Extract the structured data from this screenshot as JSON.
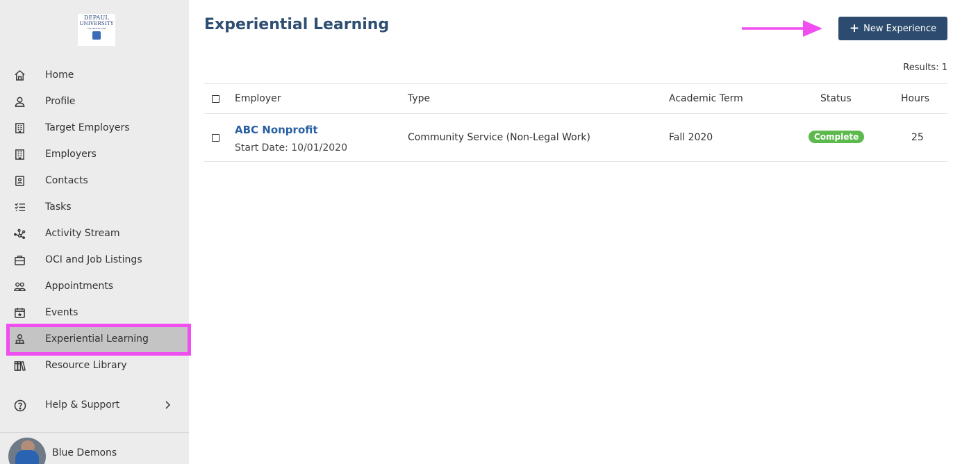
{
  "logo": {
    "line1": "DEPAUL",
    "line2": "UNIVERSITY",
    "line3": "COLLEGE OF LAW"
  },
  "sidebar": {
    "items": [
      {
        "label": "Home",
        "icon": "home-icon"
      },
      {
        "label": "Profile",
        "icon": "user-icon"
      },
      {
        "label": "Target Employers",
        "icon": "building-icon"
      },
      {
        "label": "Employers",
        "icon": "building-icon"
      },
      {
        "label": "Contacts",
        "icon": "contacts-icon"
      },
      {
        "label": "Tasks",
        "icon": "tasks-icon"
      },
      {
        "label": "Activity Stream",
        "icon": "activity-icon"
      },
      {
        "label": "OCI and Job Listings",
        "icon": "briefcase-icon"
      },
      {
        "label": "Appointments",
        "icon": "people-icon"
      },
      {
        "label": "Events",
        "icon": "calendar-icon"
      },
      {
        "label": "Experiential Learning",
        "icon": "learning-icon",
        "active": true
      },
      {
        "label": "Resource Library",
        "icon": "library-icon"
      }
    ],
    "help": "Help & Support",
    "user": "Blue Demons"
  },
  "main": {
    "title": "Experiential Learning",
    "new_button": "New Experience",
    "results": "Results: 1",
    "columns": {
      "employer": "Employer",
      "type": "Type",
      "term": "Academic Term",
      "status": "Status",
      "hours": "Hours"
    },
    "rows": [
      {
        "employer": "ABC Nonprofit",
        "start_date": "Start Date: 10/01/2020",
        "type": "Community Service (Non-Legal Work)",
        "term": "Fall 2020",
        "status": "Complete",
        "hours": "25"
      }
    ]
  },
  "colors": {
    "accent": "#2c4b6e",
    "title": "#2f4f72",
    "link": "#2960a3",
    "status_complete": "#5cb94b",
    "highlight": "#f04ef0"
  }
}
